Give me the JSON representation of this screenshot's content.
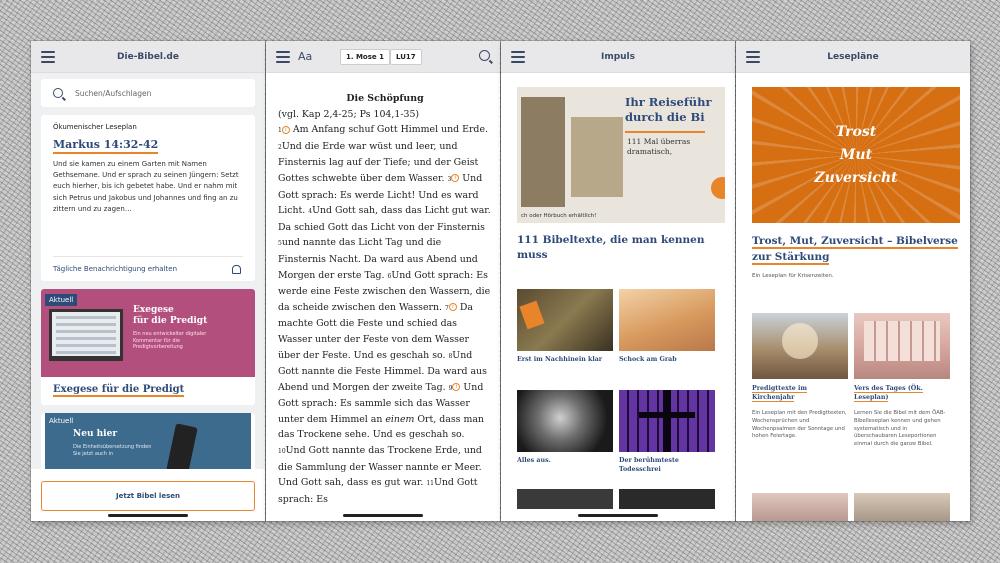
{
  "phone1": {
    "title": "Die-Bibel.de",
    "search_placeholder": "Suchen/Aufschlagen",
    "leseplan_label": "Ökumenischer Leseplan",
    "reference": "Markus 14:32-42",
    "passage": "Und sie kamen zu einem Garten mit Namen Gethsemane. Und er sprach zu seinen Jüngern: Setzt euch hierher, bis ich gebetet habe. Und er nahm mit sich Petrus und Jakobus und Johannes und fing an zu zittern und zu zagen…",
    "notify_label": "Tägliche Benachrichtigung erhalten",
    "promo1_tag": "Aktuell",
    "promo1_head_line1": "Exegese",
    "promo1_head_line2": "für die Predigt",
    "promo1_sub": "Ein neu entwickelter digitaler Kommentar für die Predigtvorbereitung",
    "promo1_title": "Exegese für die Predigt",
    "promo2_tag": "Aktuell",
    "promo2_head": "Neu hier",
    "promo2_sub": "Die Einheitsübersetzung finden Sie jetzt auch in",
    "cta": "Jetzt Bibel lesen"
  },
  "phone2": {
    "aa": "Aa",
    "book": "1. Mose 1",
    "translation": "LU17",
    "heading": "Die Schöpfung",
    "crossref": "(vgl. Kap 2,4-25; Ps 104,1-35)",
    "v1n": "1",
    "v1": "Am Anfang schuf Gott Himmel und Erde.",
    "v2n": "2",
    "v2": "Und die Erde war wüst und leer, und Finsternis lag auf der Tiefe; und der Geist Gottes schwebte über dem Wasser.",
    "v3n": "3",
    "v3": "Und Gott sprach: Es werde Licht! Und es ward Licht.",
    "v4n": "4",
    "v4": "Und Gott sah, dass das Licht gut war. Da schied Gott das Licht von der Finsternis",
    "v5n": "5",
    "v5": "und nannte das Licht Tag und die Finsternis Nacht. Da ward aus Abend und Morgen der erste Tag.",
    "v6n": "6",
    "v6": "Und Gott sprach: Es werde eine Feste zwischen den Wassern, die da scheide zwischen den Wassern.",
    "v7n": "7",
    "v7": "Da machte Gott die Feste und schied das Wasser unter der Feste von dem Wasser über der Feste. Und es geschah so.",
    "v8n": "8",
    "v8": "Und Gott nannte die Feste Himmel. Da ward aus Abend und Morgen der zweite Tag.",
    "v9n": "9",
    "v9a": "Und Gott sprach: Es sammle sich das Wasser unter dem Himmel an ",
    "v9em": "einem",
    "v9b": " Ort, dass man das Trockene sehe. Und es geschah so.",
    "v10n": "10",
    "v10": "Und Gott nannte das Trockene Erde, und die Sammlung der Wasser nannte er Meer. Und Gott sah, dass es gut war.",
    "v11n": "11",
    "v11": "Und Gott sprach: Es"
  },
  "phone3": {
    "title": "Impuls",
    "hero_head_line1": "Ihr Reiseführ",
    "hero_head_line2": "durch die Bi",
    "hero_sub_line1": "111 Mal überras",
    "hero_sub_line2": "dramatisch,",
    "hero_foot": "ch oder Hörbuch erhältlich!",
    "article_title": "111 Bibeltexte, die man kennen muss",
    "tiles": [
      {
        "caption": "Erst im Nachhinein klar"
      },
      {
        "caption": "Schock am Grab"
      },
      {
        "caption": "Alles aus."
      },
      {
        "caption": "Der berühmteste Todesschrei"
      }
    ]
  },
  "phone4": {
    "title": "Lesepläne",
    "hero_words": [
      "Trost",
      "Mut",
      "Zuversicht"
    ],
    "plan_title": "Trost, Mut, Zuversicht – Bibelverse zur Stärkung",
    "plan_sub": "Ein Leseplan für Krisenzeiten.",
    "col1_cap": "Predigttexte im Kirchenjahr",
    "col1_desc": "Ein Leseplan mit den Predigttexten, Wochensprüchen und Wochenpsalmen der Sonntage und hohen Feiertage.",
    "col2_cap": "Vers des Tages (Ök. Leseplan)",
    "col2_desc": "Lernen Sie die Bibel mit dem ÖAB-Bibelleseplan kennen und gehen systematisch und in überschaubaren Leseportionen einmal durch die ganze Bibel."
  }
}
